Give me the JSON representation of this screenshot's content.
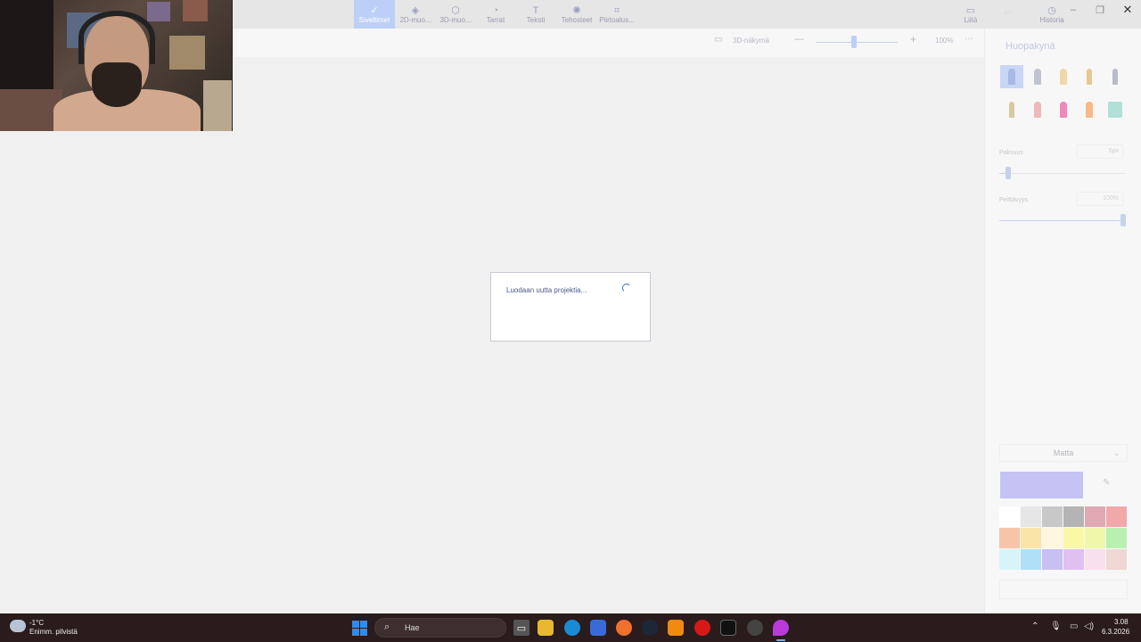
{
  "toolbar": {
    "tools": [
      {
        "label": "Siveltimet",
        "icon": "brush-icon",
        "active": true
      },
      {
        "label": "2D-muo...",
        "icon": "shapes-2d-icon",
        "active": false
      },
      {
        "label": "3D-muo...",
        "icon": "cube-icon",
        "active": false
      },
      {
        "label": "Tarrat",
        "icon": "sticker-icon",
        "active": false
      },
      {
        "label": "Teksti",
        "icon": "text-icon",
        "active": false
      },
      {
        "label": "Tehosteet",
        "icon": "effects-icon",
        "active": false
      },
      {
        "label": "Piirtoalus...",
        "icon": "canvas-icon",
        "active": false
      }
    ],
    "insert_label": "Liitä",
    "history_label": "Historia"
  },
  "subbar": {
    "view3d_label": "3D-näkymä",
    "zoom_value": "100%",
    "zoom_level": 0.47
  },
  "dialog": {
    "message": "Luodaan uutta projektia..."
  },
  "panel": {
    "title": "Huopakynä",
    "thickness_label": "Paksuus",
    "thickness_value": "5px",
    "thickness_level": 0.05,
    "opacity_label": "Peittävyys",
    "opacity_value": "100%",
    "opacity_level": 1.0,
    "finish_label": "Matta",
    "current_color": "#c5c3f3",
    "swatches": [
      "#ffffff",
      "#e6e6e6",
      "#c8c8c8",
      "#b4b4b4",
      "#e0a8b2",
      "#f0a8a8",
      "#f8c4a8",
      "#fbe4a8",
      "#fff6e0",
      "#f8f8a8",
      "#eef8a8",
      "#b8f0b0",
      "#d8f4f8",
      "#b0e0f8",
      "#c8c0f0",
      "#e0c0f0",
      "#f8e0ec",
      "#eed8d4"
    ]
  },
  "taskbar": {
    "weather_temp": "-1°C",
    "weather_desc": "Enimm. pilvistä",
    "search_label": "Hae",
    "time": "3.08",
    "date": "6.3.2026"
  }
}
